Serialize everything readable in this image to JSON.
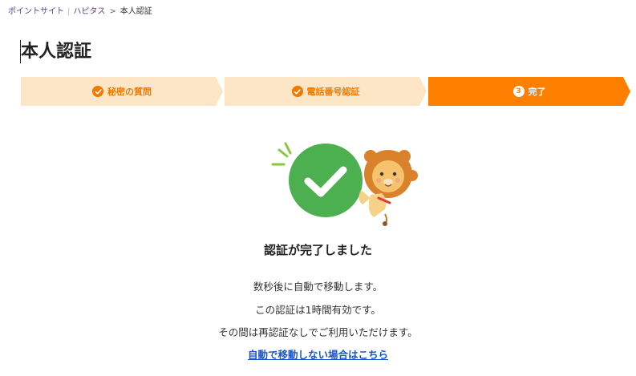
{
  "breadcrumb": {
    "items": [
      {
        "label": "ポイントサイト"
      },
      {
        "label": "ハピタス"
      }
    ],
    "current": "本人認証"
  },
  "page_title": "本人認証",
  "steps": [
    {
      "label": "秘密の質問",
      "state": "done",
      "icon": "check-icon"
    },
    {
      "label": "電話番号認証",
      "state": "done",
      "icon": "check-icon"
    },
    {
      "label": "完了",
      "state": "active",
      "number": "3"
    }
  ],
  "complete": {
    "title": "認証が完了しました",
    "messages": [
      "数秒後に自動で移動します。",
      "この認証は1時間有効です。",
      "その間は再認証なしでご利用いただけます。"
    ],
    "link_label": "自動で移動しない場合はこちら"
  },
  "colors": {
    "accent": "#fd7f00",
    "step_done_bg": "#fde6c6",
    "success_green": "#4caf50",
    "link": "#1a56c9"
  }
}
